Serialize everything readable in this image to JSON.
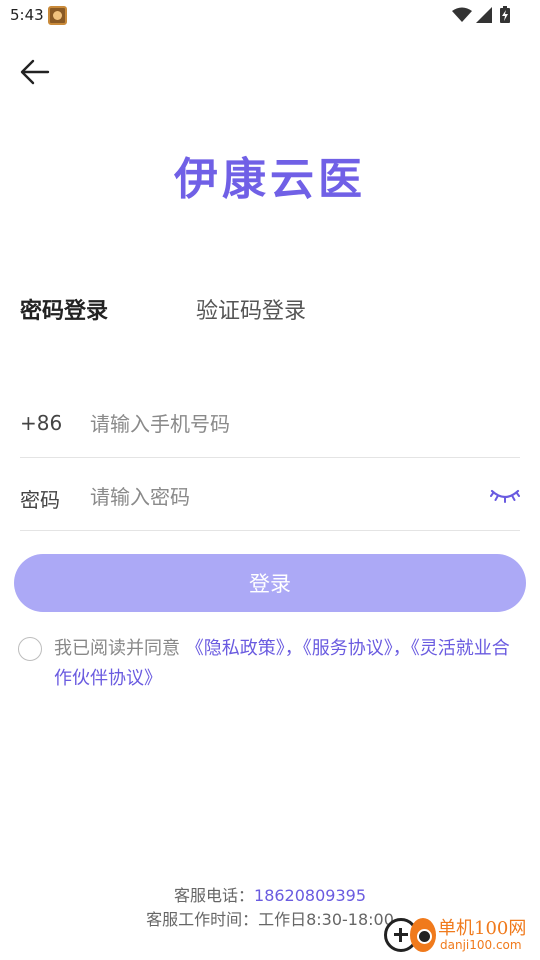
{
  "status_bar": {
    "time": "5:43",
    "icons": [
      "app-notification-icon",
      "wifi-icon",
      "signal-icon",
      "battery-charging-icon"
    ]
  },
  "header": {
    "back_icon": "arrow-left-icon",
    "app_title": "伊康云医"
  },
  "tabs": [
    {
      "label": "密码登录",
      "active": true
    },
    {
      "label": "验证码登录",
      "active": false
    }
  ],
  "form": {
    "phone": {
      "prefix": "+86",
      "placeholder": "请输入手机号码",
      "value": ""
    },
    "password": {
      "prefix": "密码",
      "placeholder": "请输入密码",
      "value": "",
      "toggle_icon": "eye-closed-icon"
    },
    "login_button": "登录"
  },
  "agreement": {
    "checked": false,
    "prefix_text": "我已阅读并同意 ",
    "privacy_link": "《隐私政策》",
    "separator_1": "，",
    "service_link": "《服务协议》",
    "separator_2": "，",
    "flexible_link": "《灵活就业合作伙伴协议》"
  },
  "footer": {
    "phone_label": "客服电话：",
    "phone_number": "18620809395",
    "hours_label": "客服工作时间：",
    "hours_value": "工作日8:30-18:00"
  },
  "watermark": {
    "name_cn": "单机100网",
    "domain": "danji100.com"
  },
  "colors": {
    "accent": "#7060e6",
    "link": "#6a5be0",
    "button_disabled": "#aca9f6",
    "divider": "#e4e4e4"
  }
}
